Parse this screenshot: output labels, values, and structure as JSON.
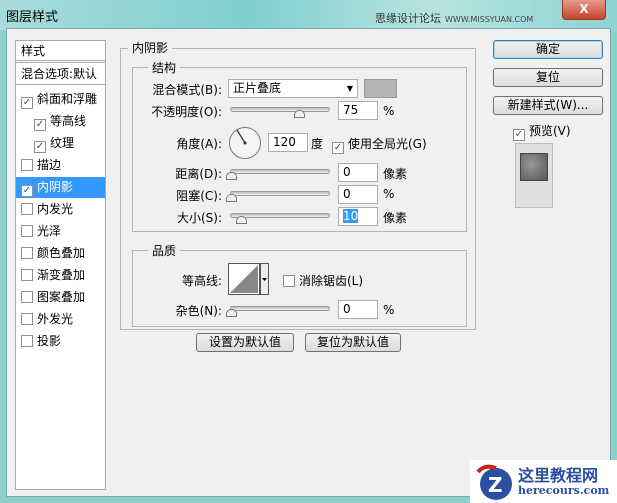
{
  "window": {
    "title": "图层样式",
    "watermark": "思缘设计论坛",
    "watermark_url": "WWW.MISSYUAN.COM",
    "close": "X"
  },
  "sidebar": {
    "header": "样式",
    "blend_options": "混合选项:默认",
    "items": [
      {
        "label": "斜面和浮雕",
        "checked": true,
        "sub": false
      },
      {
        "label": "等高线",
        "checked": true,
        "sub": true
      },
      {
        "label": "纹理",
        "checked": true,
        "sub": true
      },
      {
        "label": "描边",
        "checked": false,
        "sub": false
      },
      {
        "label": "内阴影",
        "checked": true,
        "sub": false,
        "selected": true
      },
      {
        "label": "内发光",
        "checked": false,
        "sub": false
      },
      {
        "label": "光泽",
        "checked": false,
        "sub": false
      },
      {
        "label": "颜色叠加",
        "checked": false,
        "sub": false
      },
      {
        "label": "渐变叠加",
        "checked": false,
        "sub": false
      },
      {
        "label": "图案叠加",
        "checked": false,
        "sub": false
      },
      {
        "label": "外发光",
        "checked": false,
        "sub": false
      },
      {
        "label": "投影",
        "checked": false,
        "sub": false
      }
    ]
  },
  "main": {
    "section": "内阴影",
    "structure": {
      "title": "结构",
      "blend_mode_label": "混合模式(B):",
      "blend_mode": "正片叠底",
      "shadow_color": "#b4b4b4",
      "opacity_label": "不透明度(O):",
      "opacity": "75",
      "opacity_unit": "%",
      "opacity_pct": 75,
      "angle_label": "角度(A):",
      "angle": "120",
      "angle_unit": "度",
      "global_light": "使用全局光(G)",
      "distance_label": "距离(D):",
      "distance": "0",
      "distance_unit": "像素",
      "choke_label": "阻塞(C):",
      "choke": "0",
      "choke_unit": "%",
      "size_label": "大小(S):",
      "size": "10",
      "size_unit": "像素"
    },
    "quality": {
      "title": "品质",
      "contour_label": "等高线:",
      "antialias": "消除锯齿(L)",
      "noise_label": "杂色(N):",
      "noise": "0",
      "noise_unit": "%"
    },
    "set_default": "设置为默认值",
    "reset_default": "复位为默认值"
  },
  "buttons": {
    "ok": "确定",
    "reset": "复位",
    "new_style": "新建样式(W)...",
    "preview": "预览(V)"
  },
  "logo": {
    "name": "这里教程网",
    "url": "herecours.com"
  }
}
